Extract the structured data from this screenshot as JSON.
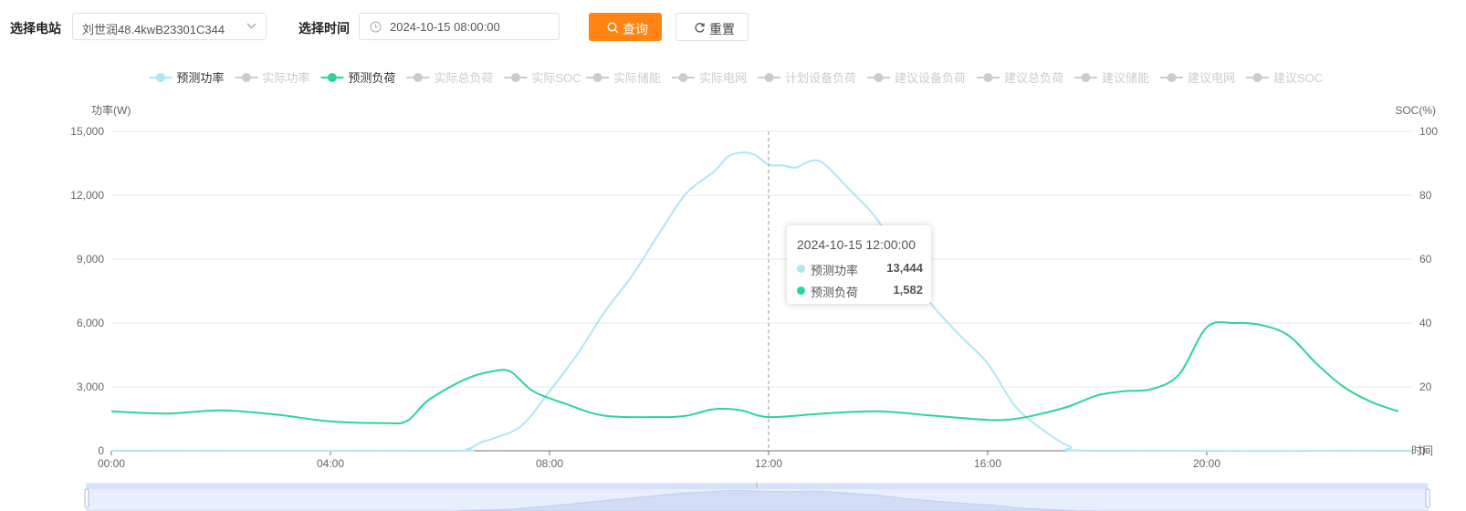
{
  "toolbar": {
    "station_label": "选择电站",
    "station_value": "刘世润48.4kwB23301C344",
    "time_label": "选择时间",
    "time_value": "2024-10-15 08:00:00",
    "query_label": "查询",
    "reset_label": "重置",
    "accent": "#ff8412"
  },
  "tooltip": {
    "title": "2024-10-15 12:00:00",
    "rows": [
      {
        "name": "预测功率",
        "value": "13,444",
        "color": "#aee6f4"
      },
      {
        "name": "预测负荷",
        "value": "1,582",
        "color": "#2dd49a"
      }
    ]
  },
  "chart_data": {
    "type": "line",
    "legend": [
      {
        "name": "预测功率",
        "active": true,
        "color": "#aee6f4"
      },
      {
        "name": "实际功率",
        "active": false
      },
      {
        "name": "预测负荷",
        "active": true,
        "color": "#2dd49a"
      },
      {
        "name": "实际总负荷",
        "active": false
      },
      {
        "name": "实际SOC",
        "active": false
      },
      {
        "name": "实际储能",
        "active": false
      },
      {
        "name": "实际电网",
        "active": false
      },
      {
        "name": "计划设备负荷",
        "active": false
      },
      {
        "name": "建议设备负荷",
        "active": false
      },
      {
        "name": "建议总负荷",
        "active": false
      },
      {
        "name": "建议储能",
        "active": false
      },
      {
        "name": "建议电网",
        "active": false
      },
      {
        "name": "建议SOC",
        "active": false
      }
    ],
    "legend_inactive_color": "#cccccc",
    "legend_placement": "top-center",
    "ylabel_left": "功率(W)",
    "ylabel_right": "SOC(%)",
    "xlabel": "时间",
    "ylim_left": [
      0,
      15000
    ],
    "ylim_right": [
      0,
      100
    ],
    "yticks_left": [
      "0",
      "3,000",
      "6,000",
      "9,000",
      "12,000",
      "15,000"
    ],
    "yticks_right": [
      "0",
      "20",
      "40",
      "60",
      "80",
      "100"
    ],
    "xlim_hours": [
      0,
      23.75
    ],
    "xticks": [
      "00:00",
      "04:00",
      "08:00",
      "12:00",
      "16:00",
      "20:00"
    ],
    "grid": true,
    "crosshair_time": "12:00",
    "series": [
      {
        "name": "预测功率",
        "color": "#aee6f4",
        "points": [
          [
            0,
            0
          ],
          [
            6,
            0
          ],
          [
            6.5,
            80
          ],
          [
            6.75,
            400
          ],
          [
            7,
            600
          ],
          [
            7.5,
            1200
          ],
          [
            8,
            2800
          ],
          [
            8.5,
            4500
          ],
          [
            9,
            6500
          ],
          [
            9.5,
            8200
          ],
          [
            10,
            10200
          ],
          [
            10.5,
            12100
          ],
          [
            11,
            13100
          ],
          [
            11.25,
            13800
          ],
          [
            11.5,
            14000
          ],
          [
            11.75,
            13900
          ],
          [
            12,
            13444
          ],
          [
            12.25,
            13400
          ],
          [
            12.5,
            13300
          ],
          [
            12.75,
            13600
          ],
          [
            13,
            13500
          ],
          [
            13.5,
            12200
          ],
          [
            14,
            10800
          ],
          [
            14.5,
            8500
          ],
          [
            15,
            6800
          ],
          [
            15.5,
            5400
          ],
          [
            16,
            4100
          ],
          [
            16.5,
            2100
          ],
          [
            17,
            1000
          ],
          [
            17.5,
            200
          ],
          [
            18,
            0
          ],
          [
            23.75,
            0
          ]
        ]
      },
      {
        "name": "预测负荷",
        "color": "#2dd49a",
        "points": [
          [
            0,
            1850
          ],
          [
            1,
            1750
          ],
          [
            2,
            1900
          ],
          [
            3,
            1700
          ],
          [
            4,
            1380
          ],
          [
            5,
            1300
          ],
          [
            5.4,
            1400
          ],
          [
            5.8,
            2400
          ],
          [
            6.5,
            3400
          ],
          [
            7,
            3750
          ],
          [
            7.3,
            3700
          ],
          [
            7.7,
            2800
          ],
          [
            8.3,
            2200
          ],
          [
            9,
            1650
          ],
          [
            10,
            1580
          ],
          [
            10.5,
            1650
          ],
          [
            11,
            1950
          ],
          [
            11.5,
            1900
          ],
          [
            12,
            1582
          ],
          [
            13,
            1750
          ],
          [
            14,
            1850
          ],
          [
            15,
            1650
          ],
          [
            16,
            1450
          ],
          [
            16.5,
            1500
          ],
          [
            17,
            1750
          ],
          [
            17.5,
            2100
          ],
          [
            18,
            2600
          ],
          [
            18.5,
            2800
          ],
          [
            19,
            2900
          ],
          [
            19.5,
            3600
          ],
          [
            20,
            5800
          ],
          [
            20.5,
            6000
          ],
          [
            21,
            5900
          ],
          [
            21.5,
            5400
          ],
          [
            22,
            4100
          ],
          [
            22.5,
            3000
          ],
          [
            23,
            2300
          ],
          [
            23.5,
            1850
          ]
        ]
      }
    ]
  }
}
